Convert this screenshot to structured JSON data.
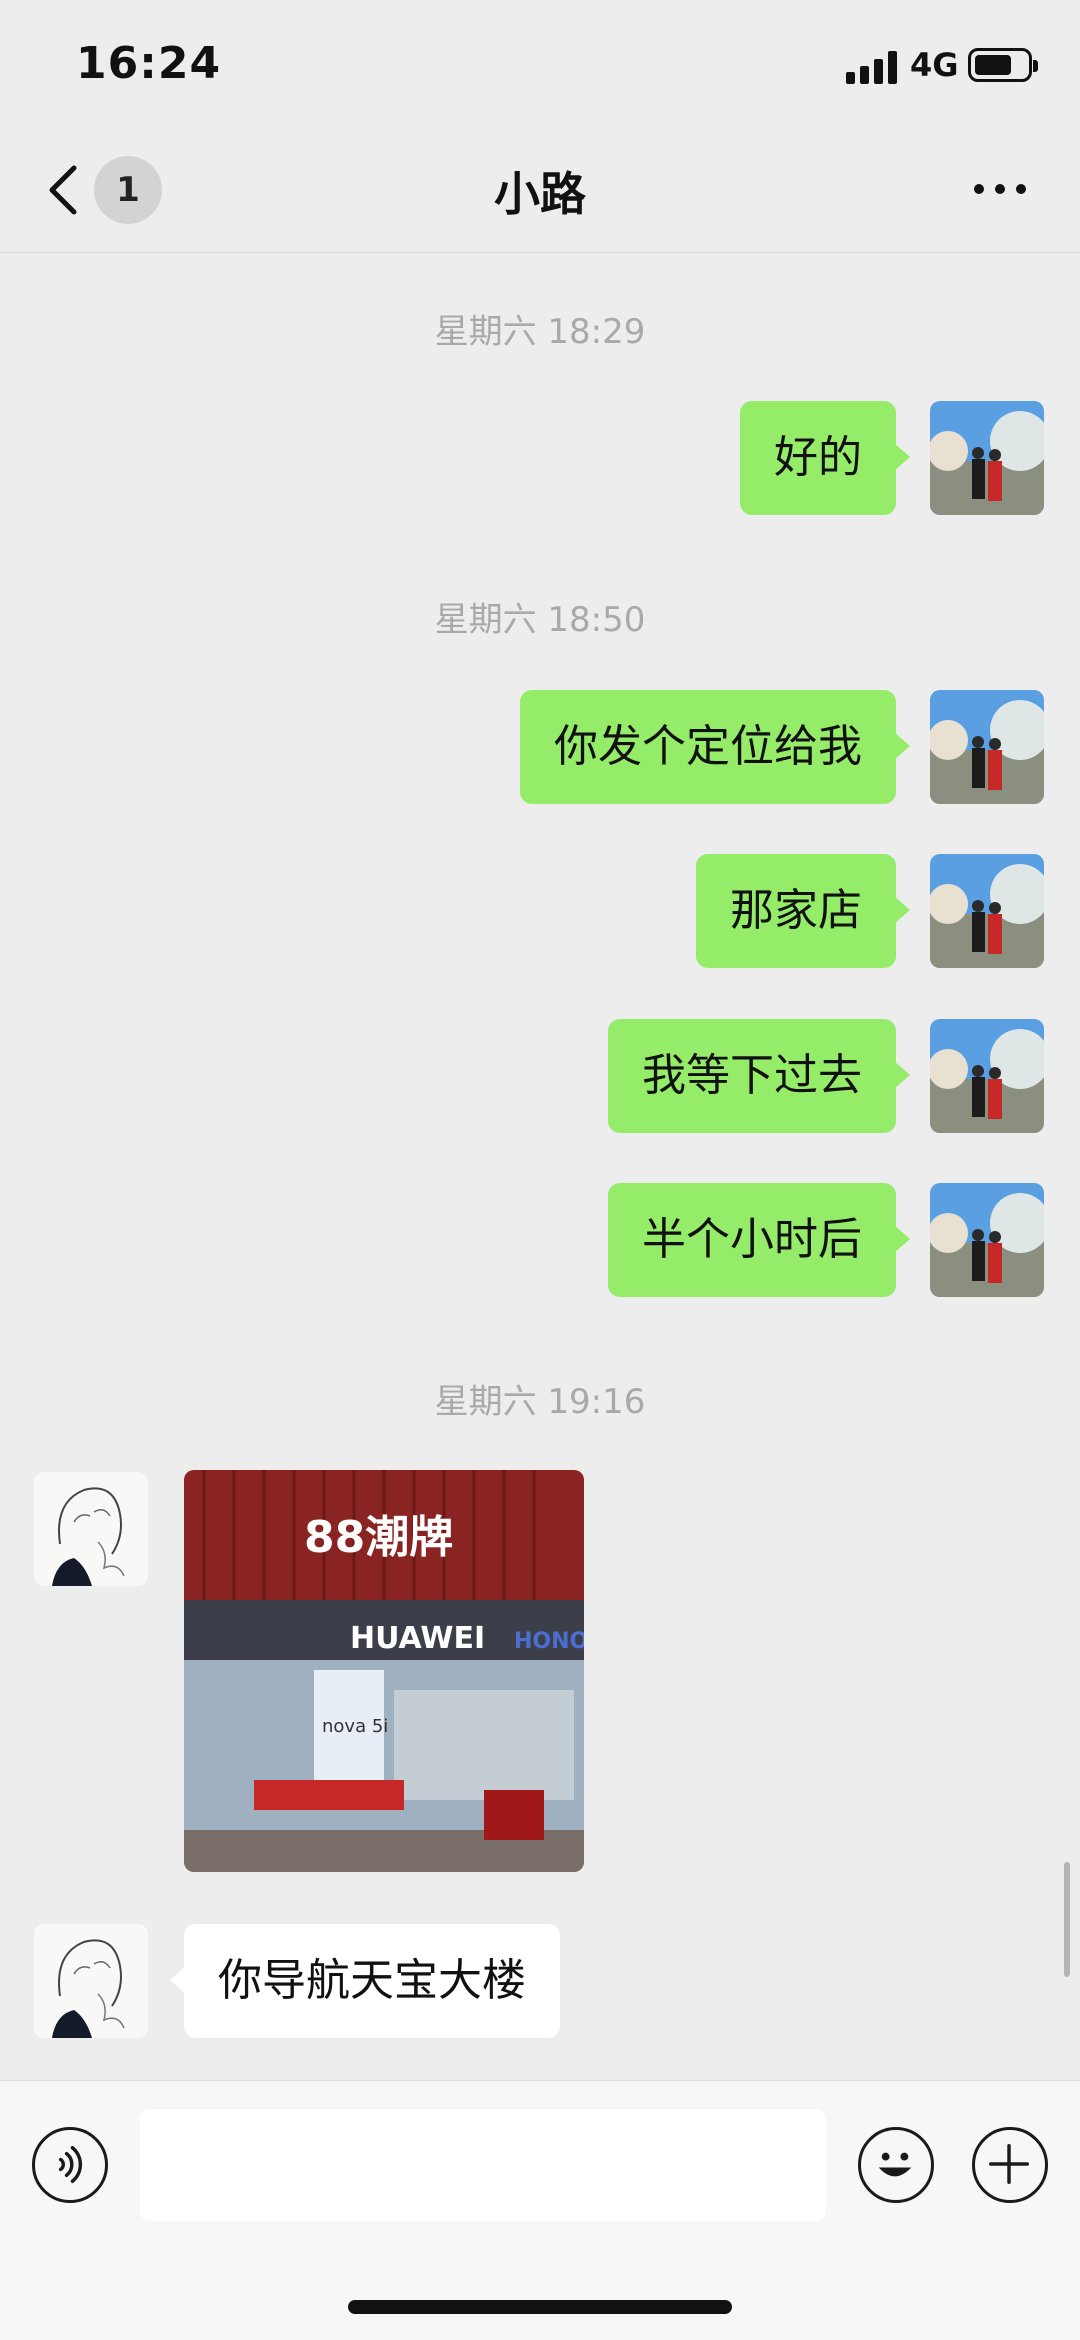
{
  "status_bar": {
    "time": "16:24",
    "network": "4G"
  },
  "nav": {
    "unread_count": "1",
    "title": "小路"
  },
  "timestamps": [
    "星期六 18:29",
    "星期六 18:50",
    "星期六 19:16"
  ],
  "messages": [
    {
      "direction": "out",
      "text": "好的"
    },
    {
      "direction": "out",
      "text": "你发个定位给我"
    },
    {
      "direction": "out",
      "text": "那家店"
    },
    {
      "direction": "out",
      "text": "我等下过去"
    },
    {
      "direction": "out",
      "text": "半个小时后"
    },
    {
      "direction": "in",
      "type": "image"
    },
    {
      "direction": "in",
      "text": "你导航天宝大楼"
    }
  ],
  "photo_signs": {
    "brand": "HUAWEI",
    "shop": "88潮牌",
    "model": "nova 5i",
    "honor": "HONOR"
  },
  "colors": {
    "outgoing_bubble": "#95ec69",
    "incoming_bubble": "#ffffff",
    "background": "#ededed",
    "timestamp": "#a9a9a9"
  },
  "icons": [
    "back-arrow-icon",
    "more-icon",
    "voice-icon",
    "emoji-icon",
    "plus-icon"
  ]
}
